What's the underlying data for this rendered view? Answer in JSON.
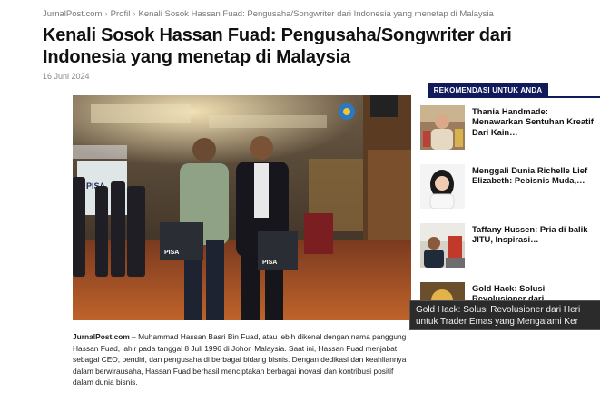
{
  "breadcrumb": {
    "site": "JurnalPost.com",
    "section": "Profil",
    "current": "Kenali Sosok Hassan Fuad: Pengusaha/Songwriter dari Indonesia yang menetap di Malaysia",
    "separator": "›"
  },
  "article": {
    "title": "Kenali Sosok Hassan Fuad: Pengusaha/Songwriter dari Indonesia yang menetap di Malaysia",
    "date": "16 Juni 2024",
    "hero_signage": "PISA",
    "hero_bag_label": "PISA",
    "lead_source": "JurnalPost.com",
    "lead_text": " – Muhammad Hassan Basri Bin Fuad, atau lebih dikenal dengan nama panggung Hassan Fuad, lahir pada tanggal 8 Juli 1996 di Johor, Malaysia. Saat ini, Hassan Fuad menjabat sebagai CEO, pendiri, dan pengusaha di berbagai bidang bisnis. Dengan dedikasi dan keahliannya dalam berwirausaha, Hassan Fuad berhasil menciptakan berbagai inovasi dan kontribusi positif dalam dunia bisnis."
  },
  "sidebar": {
    "heading": "REKOMENDASI UNTUK ANDA",
    "items": [
      {
        "title": "Thania Handmade: Menawarkan Sentuhan Kreatif Dari Kain…"
      },
      {
        "title": "Menggali Dunia Richelle Lief Elizabeth: Pebisnis Muda,…"
      },
      {
        "title": "Taffany Hussen: Pria di balik JITU, Inspirasi…"
      },
      {
        "title": "Gold Hack: Solusi Revolusioner dari"
      }
    ]
  },
  "tooltip": {
    "line1": "Gold Hack: Solusi Revolusioner dari Heri",
    "line2": "untuk Trader Emas yang Mengalami Ker"
  }
}
